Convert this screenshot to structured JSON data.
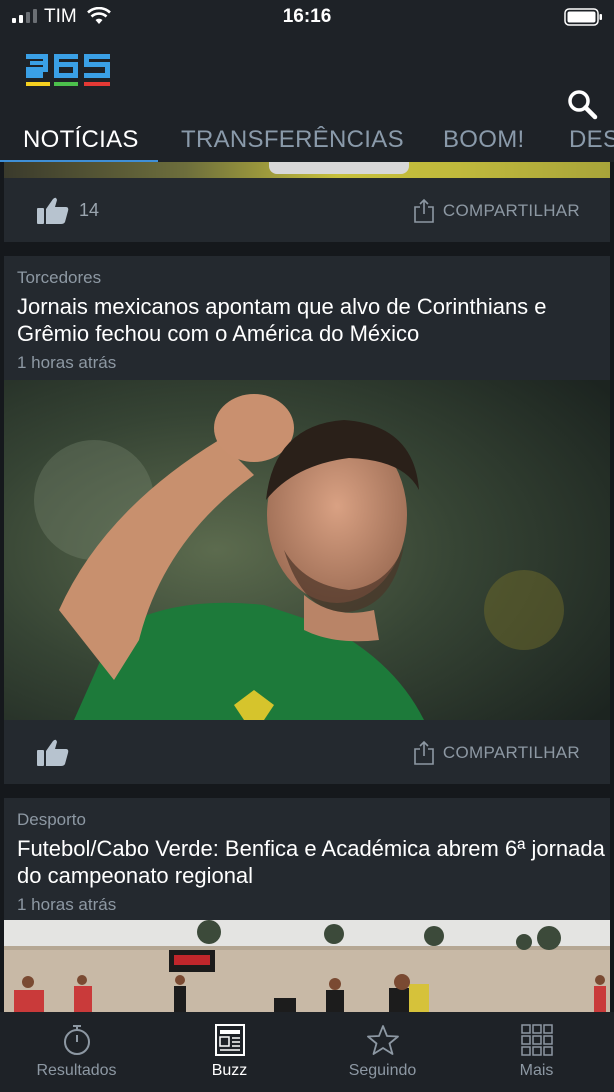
{
  "status_bar": {
    "carrier": "TIM",
    "time": "16:16"
  },
  "header": {
    "logo_text": "365",
    "search_icon": "search-icon"
  },
  "tabs": [
    {
      "label": "NOTÍCIAS",
      "active": true
    },
    {
      "label": "TRANSFERÊNCIAS",
      "active": false
    },
    {
      "label": "BOOM!",
      "active": false
    },
    {
      "label": "DES",
      "active": false
    }
  ],
  "feed": {
    "first_card": {
      "likes": "14",
      "share_label": "COMPARTILHAR"
    },
    "articles": [
      {
        "category": "Torcedores",
        "headline": "Jornais mexicanos apontam que alvo de Corinthians e Grêmio fechou com o América do México",
        "time": "1 horas atrás",
        "share_label": "COMPARTILHAR"
      },
      {
        "category": "Desporto",
        "headline": "Futebol/Cabo Verde: Benfica e Académica abrem 6ª jornada do campeonato regional",
        "time": "1 horas atrás"
      }
    ]
  },
  "bottom_nav": [
    {
      "label": "Resultados",
      "icon": "stopwatch-icon",
      "active": false
    },
    {
      "label": "Buzz",
      "icon": "newspaper-icon",
      "active": true
    },
    {
      "label": "Seguindo",
      "icon": "star-icon",
      "active": false
    },
    {
      "label": "Mais",
      "icon": "grid-icon",
      "active": false
    }
  ],
  "colors": {
    "accent": "#3f8fd6",
    "background": "#1a1e23",
    "card": "#24292f"
  }
}
